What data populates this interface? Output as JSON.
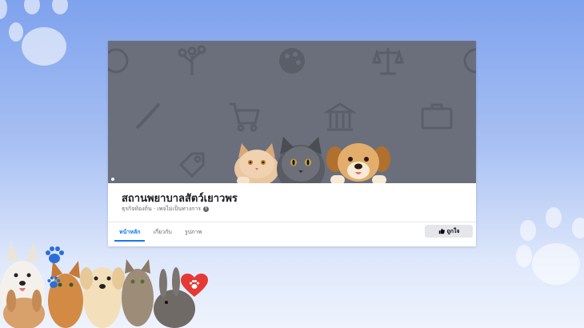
{
  "page": {
    "title": "สถานพยาบาลสัตว์เยาวพร",
    "subtitle": "ธุรกิจท้องถิ่น · เพจไม่เป็นทางการ",
    "info_icon": "info-icon"
  },
  "tabs": [
    {
      "label": "หน้าหลัก",
      "active": true
    },
    {
      "label": "เกี่ยวกับ",
      "active": false
    },
    {
      "label": "รูปภาพ",
      "active": false
    }
  ],
  "like_button": {
    "label": "ถูกใจ",
    "icon": "thumbs-up-icon"
  },
  "colors": {
    "accent": "#1877f2",
    "cover": "#6b6f7c",
    "heart": "#e53935",
    "paw_blue": "#2a6fd6"
  }
}
